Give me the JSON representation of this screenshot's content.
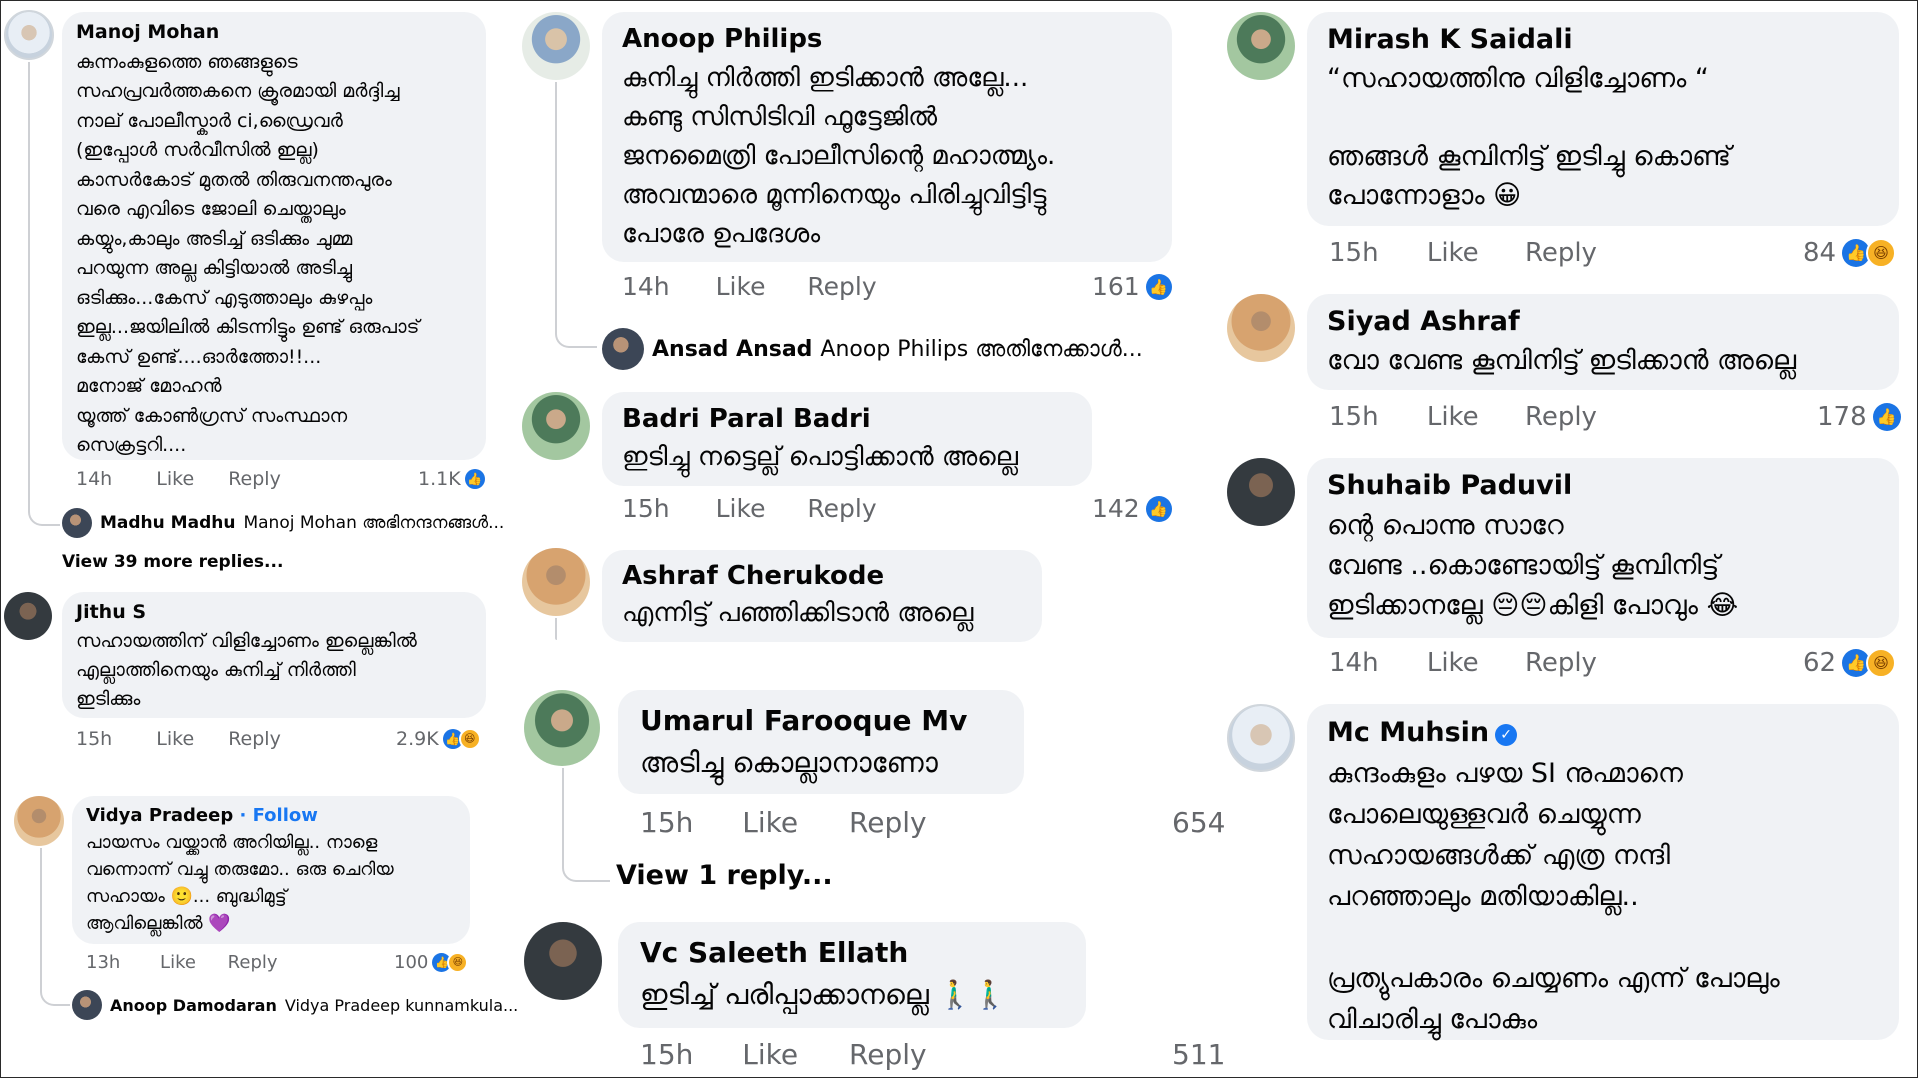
{
  "col1": {
    "manoj": {
      "name": "Manoj Mohan",
      "text": "കുന്നംകുളത്തെ ഞങ്ങളുടെ\nസഹപ്രവർത്തകനെ ക്രൂരമായി മർദ്ദിച്ച\nനാല് പോലീസ്കാർ ci,ഡ്രൈവർ\n(ഇപ്പോൾ സർവീസിൽ ഇല്ല)\nകാസർകോട് മുതൽ തിരുവനന്തപുരം\nവരെ എവിടെ ജോലി ചെയ്താലും\nകയ്യും,കാലും അടിച്ച് ഒടിക്കും ചുമ്മ\nപറയുന്ന അല്ല കിട്ടിയാൽ അടിച്ചു\nഒടിക്കും...കേസ് എടുത്താലും കുഴപ്പം\nഇല്ല...ജയിലിൽ കിടന്നിട്ടും ഉണ്ട് ഒരുപാട്\nകേസ് ഉണ്ട്....ഓർത്തോ!!...\nമനോജ് മോഹൻ\nയൂത്ത് കോൺഗ്രസ് സംസ്ഥാന\nസെക്രട്ടറി....",
      "time": "14h",
      "like": "Like",
      "reply": "Reply",
      "count": "1.1K"
    },
    "madhu": {
      "name": "Madhu Madhu",
      "text": "Manoj Mohan അഭിനന്ദനങ്ങൾ..."
    },
    "view_more": "View 39 more replies...",
    "jithu": {
      "name": "Jithu S",
      "text": "സഹായത്തിന് വിളിച്ചോണം ഇല്ലെങ്കിൽ\nഎല്ലാത്തിനെയും കുനിച്ച് നിർത്തി\nഇടിക്കും",
      "time": "15h",
      "like": "Like",
      "reply": "Reply",
      "count": "2.9K"
    },
    "vidya": {
      "name": "Vidya Pradeep",
      "follow": "· Follow",
      "text": "പായസം വയ്ക്കാൻ അറിയില്ല.. നാളെ\nവന്നൊന്ന് വച്ചു തരുമോ.. ഒരു ചെറിയ\nസഹായം 🙂... ബുദ്ധിമുട്ട്\nആവില്ലെങ്കിൽ 💜",
      "time": "13h",
      "like": "Like",
      "reply": "Reply",
      "count": "100"
    },
    "anoopd": {
      "name": "Anoop Damodaran",
      "text": "Vidya Pradeep kunnamkula..."
    }
  },
  "col2": {
    "anoop": {
      "name": "Anoop Philips",
      "text": "കുനിച്ചു നിർത്തി ഇടിക്കാൻ അല്ലേ...\nകണ്ടു സിസിടിവി ഫൂട്ടേജിൽ\nജനമൈത്രി പോലീസിന്റെ മഹാത്മ്യം.\nഅവന്മാരെ മൂന്നിനെയും പിരിച്ചുവിട്ടിട്ടു\nപോരേ ഉപദേശം",
      "time": "14h",
      "like": "Like",
      "reply": "Reply",
      "count": "161"
    },
    "ansad": {
      "name": "Ansad Ansad",
      "text": "Anoop Philips അതിനേക്കാൾ..."
    },
    "badri": {
      "name": "Badri Paral Badri",
      "text": "ഇടിച്ചു നട്ടെല്ല് പൊട്ടിക്കാൻ അല്ലെ",
      "time": "15h",
      "like": "Like",
      "reply": "Reply",
      "count": "142"
    },
    "ashraf": {
      "name": "Ashraf Cherukode",
      "text": "എന്നിട്ട് പഞ്ഞിക്കിടാൻ അല്ലെ"
    },
    "umarul": {
      "name": "Umarul Farooque Mv",
      "text": "അടിച്ചു കൊല്ലാനാണോ",
      "time": "15h",
      "like": "Like",
      "reply": "Reply",
      "count": "654"
    },
    "view_reply": "View 1 reply...",
    "saleeth": {
      "name": "Vc Saleeth Ellath",
      "text": "ഇടിച്ച് പരിപ്പാക്കാനല്ലെ 🚶‍♂️🚶‍♂️",
      "time": "15h",
      "like": "Like",
      "reply": "Reply",
      "count": "511"
    }
  },
  "col3": {
    "mirash": {
      "name": "Mirash K Saidali",
      "text": "“സഹായത്തിനു വിളിച്ചോണം “\n\nഞങ്ങൾ കൂമ്പിനിട്ട് ഇടിച്ചു കൊണ്ട്\nപോന്നോളാം 😀",
      "time": "15h",
      "like": "Like",
      "reply": "Reply",
      "count": "84"
    },
    "siyad": {
      "name": "Siyad Ashraf",
      "text": "വോ വേണ്ട കൂമ്പിനിട്ട് ഇടിക്കാൻ അല്ലെ",
      "time": "15h",
      "like": "Like",
      "reply": "Reply",
      "count": "178"
    },
    "shuhaib": {
      "name": "Shuhaib Paduvil",
      "text": "ന്റെ പൊന്നു സാറേ\nവേണ്ട ..കൊണ്ടോയിട്ട് കൂമ്പിനിട്ട്\nഇടിക്കാനല്ലേ 😔😔കിളി പോവും 😂",
      "time": "14h",
      "like": "Like",
      "reply": "Reply",
      "count": "62"
    },
    "muhsin": {
      "name": "Mc Muhsin",
      "text": "കുന്ദംകുളം പഴയ SI നുഹ്മാനെ\nപോലെയുള്ളവർ ചെയ്യുന്ന\nസഹായങ്ങൾക്ക് എത്ര നന്ദി\nപറഞ്ഞാലും മതിയാകില്ല..\n\nപ്രത്യുപകാരം ചെയ്യണം എന്ന് പോലും\nവിചാരിച്ചു പോകും"
    }
  },
  "icons": {
    "like": "👍",
    "haha": "😆",
    "verified": "✓"
  },
  "colors": {
    "bubble": "#f0f2f5",
    "meta": "#65676b",
    "like_blue": "#1b74e4",
    "link_blue": "#1877f2"
  }
}
